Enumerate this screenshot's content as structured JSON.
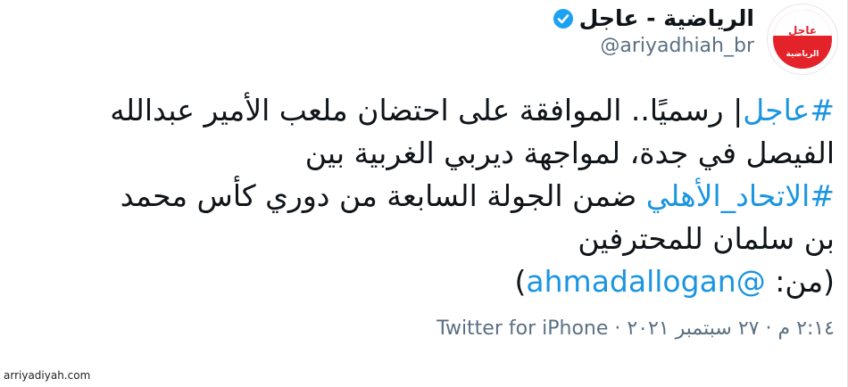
{
  "header": {
    "display_name": "الرياضية - عاجل",
    "handle": "@ariyadhiah_br",
    "avatar_top_text": "عاجل",
    "avatar_bottom_text": "الرياضية"
  },
  "tweet": {
    "line1_hashtag": "#عاجل",
    "line1_text": "| رسميًا.. الموافقة على احتضان ملعب الأمير عبدالله",
    "line2_text": "الفيصل في جدة، لمواجهة ديربي الغربية بين",
    "line3_hashtag": "#الاتحاد_الأهلي",
    "line3_text": " ضمن الجولة السابعة من دوري كأس محمد",
    "line4_text": "بن سلمان للمحترفين",
    "line5_prefix": "(من: ",
    "line5_mention": "@ahmadallogan",
    "line5_suffix": ")"
  },
  "meta": {
    "time": "٢:١٤ م",
    "separator": "·",
    "date": "٢٧ سبتمبر ٢٠٢١",
    "app": "Twitter for iPhone"
  },
  "watermark": "arriyadiyah.com",
  "colors": {
    "link": "#1b95e0",
    "verified": "#1da1f2",
    "brand_red": "#e4222a",
    "muted": "#5b7083"
  }
}
